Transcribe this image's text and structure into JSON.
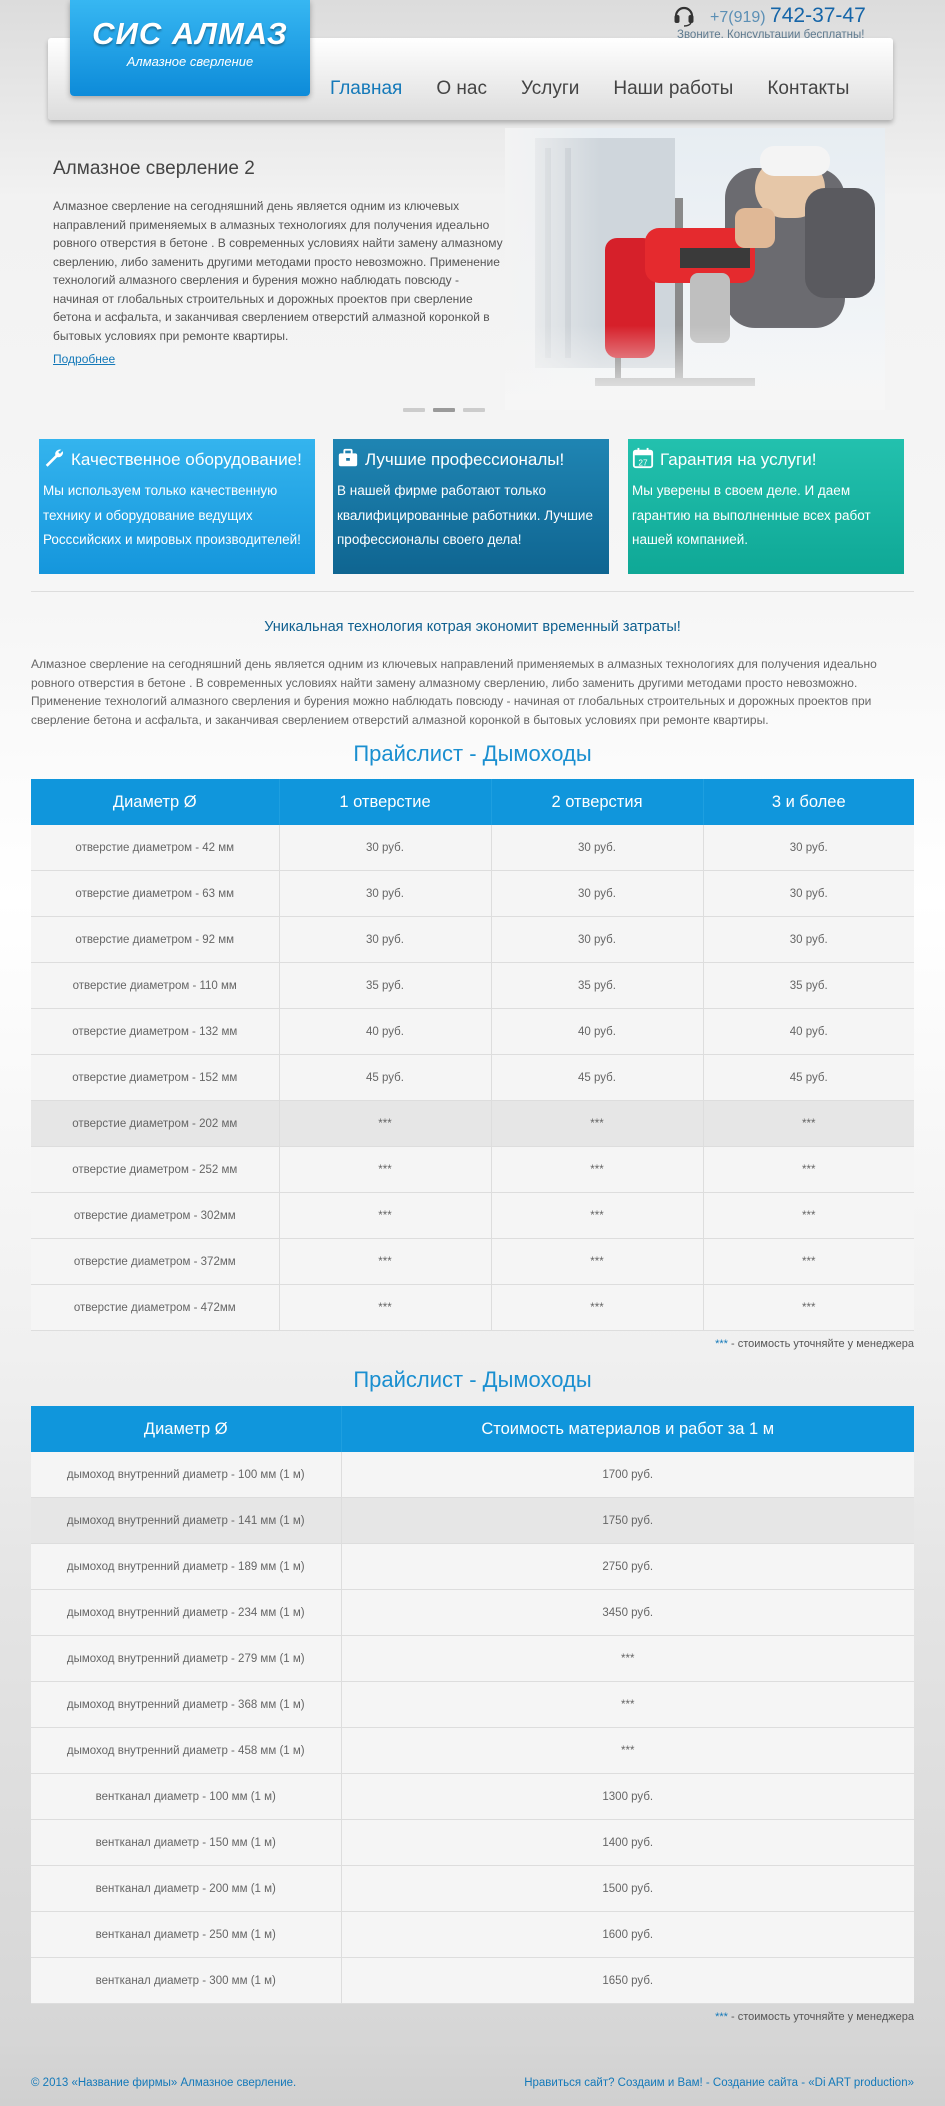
{
  "logo": {
    "title": "СИС АЛМАЗ",
    "subtitle": "Алмазное сверление"
  },
  "contact": {
    "phone_prefix": "+7(919)",
    "phone_number": "742-37-47",
    "note": "Звоните. Консультации бесплатны!"
  },
  "nav": [
    {
      "label": "Главная",
      "active": true
    },
    {
      "label": "О нас"
    },
    {
      "label": "Услуги"
    },
    {
      "label": "Наши работы"
    },
    {
      "label": "Контакты"
    }
  ],
  "hero": {
    "title": "Алмазное сверление 2",
    "text": "Алмазное сверление на сегодняшний день является одним из ключевых направлений применяемых в алмазных технологиях для получения идеально ровного отверстия в бетоне . В современных условиях найти замену алмазному сверлению, либо заменить другими методами просто невозможно. Применение технологий алмазного сверления и бурения можно наблюдать повсюду - начиная от глобальных строительных и дорожных проектов при сверление бетона и асфальта, и заканчивая сверлением отверстий алмазной коронкой в бытовых условиях при ремонте квартиры.",
    "more": "Подробнее",
    "slides": 3,
    "active_slide": 2
  },
  "features": [
    {
      "icon": "wrench-icon",
      "title": "Качественное оборудование!",
      "text": "Мы используем только качественную технику и оборудование ведущих Росссийских и мировых производителей!"
    },
    {
      "icon": "briefcase-icon",
      "title": "Лучшие профессионалы!",
      "text": "В нашей фирме работают только квалифицированные работники. Лучшие профессионалы своего дела!"
    },
    {
      "icon": "calendar-icon",
      "title": "Гарантия на услуги!",
      "calendar_day": "27",
      "text": "Мы уверены в своем деле. И даем гарантию на выполненные всех работ нашей компанией."
    }
  ],
  "tagline": "Уникальная технология котрая экономит временный затраты!",
  "intro": "Алмазное сверление на сегодняшний день является одним из ключевых направлений применяемых в алмазных технологиях для получения идеально ровного отверстия в бетоне . В современных условиях найти замену алмазному сверлению, либо заменить другими методами просто невозможно. Применение технологий алмазного сверления и бурения можно наблюдать повсюду - начиная от глобальных строительных и дорожных проектов при сверление бетона и асфальта, и заканчивая сверлением отверстий алмазной коронкой в бытовых условиях при ремонте квартиры.",
  "table1": {
    "title": "Прайслист - Дымоходы",
    "headers": [
      "Диаметр Ø",
      "1 отверстие",
      "2 отверстия",
      "3 и более"
    ],
    "rows": [
      {
        "cells": [
          "отверстие диаметром - 42 мм",
          "30 руб.",
          "30 руб.",
          "30 руб."
        ]
      },
      {
        "cells": [
          "отверстие диаметром - 63 мм",
          "30 руб.",
          "30 руб.",
          "30 руб."
        ]
      },
      {
        "cells": [
          "отверстие диаметром - 92 мм",
          "30 руб.",
          "30 руб.",
          "30 руб."
        ]
      },
      {
        "cells": [
          "отверстие диаметром - 110 мм",
          "35 руб.",
          "35 руб.",
          "35 руб."
        ]
      },
      {
        "cells": [
          "отверстие диаметром - 132 мм",
          "40 руб.",
          "40 руб.",
          "40 руб."
        ]
      },
      {
        "cells": [
          "отверстие диаметром - 152 мм",
          "45 руб.",
          "45 руб.",
          "45 руб."
        ]
      },
      {
        "cells": [
          "отверстие диаметром - 202 мм",
          "***",
          "***",
          "***"
        ],
        "highlight": true
      },
      {
        "cells": [
          "отверстие диаметром - 252 мм",
          "***",
          "***",
          "***"
        ]
      },
      {
        "cells": [
          "отверстие диаметром - 302мм",
          "***",
          "***",
          "***"
        ]
      },
      {
        "cells": [
          "отверстие диаметром - 372мм",
          "***",
          "***",
          "***"
        ]
      },
      {
        "cells": [
          "отверстие диаметром - 472мм",
          "***",
          "***",
          "***"
        ]
      }
    ],
    "note_stars": "***",
    "note_text": " - стоимость уточняйте у менеджера"
  },
  "table2": {
    "title": "Прайслист - Дымоходы",
    "headers": [
      "Диаметр Ø",
      "Стоимость материалов и работ за 1 м"
    ],
    "rows": [
      {
        "cells": [
          "дымоход внутренний диаметр - 100 мм (1 м)",
          "1700 руб."
        ]
      },
      {
        "cells": [
          "дымоход внутренний диаметр - 141 мм (1 м)",
          "1750 руб."
        ],
        "highlight": true
      },
      {
        "cells": [
          "дымоход внутренний диаметр - 189 мм (1 м)",
          "2750 руб."
        ]
      },
      {
        "cells": [
          "дымоход внутренний диаметр - 234 мм (1 м)",
          "3450 руб."
        ]
      },
      {
        "cells": [
          "дымоход внутренний диаметр - 279 мм (1 м)",
          "***"
        ]
      },
      {
        "cells": [
          "дымоход внутренний диаметр - 368 мм (1 м)",
          "***"
        ]
      },
      {
        "cells": [
          "дымоход внутренний диаметр - 458 мм (1 м)",
          "***"
        ]
      },
      {
        "cells": [
          "вентканал диаметр - 100 мм (1 м)",
          "1300 руб."
        ]
      },
      {
        "cells": [
          "вентканал диаметр - 150 мм (1 м)",
          "1400 руб."
        ]
      },
      {
        "cells": [
          "вентканал диаметр - 200 мм (1 м)",
          "1500 руб."
        ]
      },
      {
        "cells": [
          "вентканал диаметр - 250 мм (1 м)",
          "1600 руб."
        ]
      },
      {
        "cells": [
          "вентканал диаметр - 300 мм (1 м)",
          "1650 руб."
        ]
      }
    ],
    "note_stars": "***",
    "note_text": " - стоимость уточняйте у менеджера"
  },
  "footer": {
    "left": "© 2013 «Название фирмы» Алмазное сверление.",
    "right": "Нравиться сайт? Создаим и Вам! - Создание сайта - «Di ART production»"
  }
}
